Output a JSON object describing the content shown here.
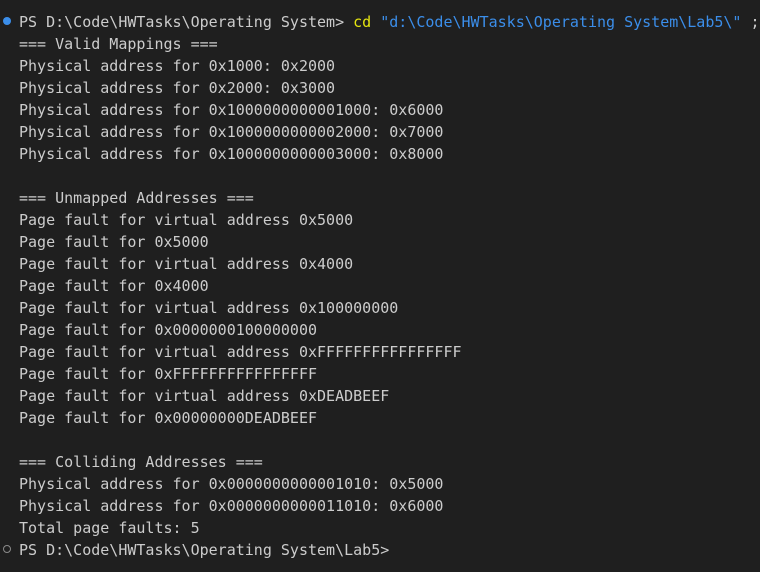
{
  "colors": {
    "background": "#1f1f1f",
    "text": "#cccccc",
    "command": "#e5e510",
    "string": "#3b8eea",
    "decoration_success": "#3b8eea",
    "decoration_default": "#8a8a8a"
  },
  "terminal": {
    "command_line": {
      "prompt": "PS D:\\Code\\HWTasks\\Operating System> ",
      "command": "cd",
      "argument": "\"d:\\Code\\HWTasks\\Operating System\\Lab5\\\"",
      "suffix": " ;"
    },
    "output": [
      "=== Valid Mappings ===",
      "Physical address for 0x1000: 0x2000",
      "Physical address for 0x2000: 0x3000",
      "Physical address for 0x1000000000001000: 0x6000",
      "Physical address for 0x1000000000002000: 0x7000",
      "Physical address for 0x1000000000003000: 0x8000",
      "",
      "=== Unmapped Addresses ===",
      "Page fault for virtual address 0x5000",
      "Page fault for 0x5000",
      "Page fault for virtual address 0x4000",
      "Page fault for 0x4000",
      "Page fault for virtual address 0x100000000",
      "Page fault for 0x0000000100000000",
      "Page fault for virtual address 0xFFFFFFFFFFFFFFFF",
      "Page fault for 0xFFFFFFFFFFFFFFFF",
      "Page fault for virtual address 0xDEADBEEF",
      "Page fault for 0x00000000DEADBEEF",
      "",
      "=== Colliding Addresses ===",
      "Physical address for 0x0000000000001010: 0x5000",
      "Physical address for 0x0000000000011010: 0x6000",
      "Total page faults: 5"
    ],
    "final_prompt": "PS D:\\Code\\HWTasks\\Operating System\\Lab5>"
  }
}
